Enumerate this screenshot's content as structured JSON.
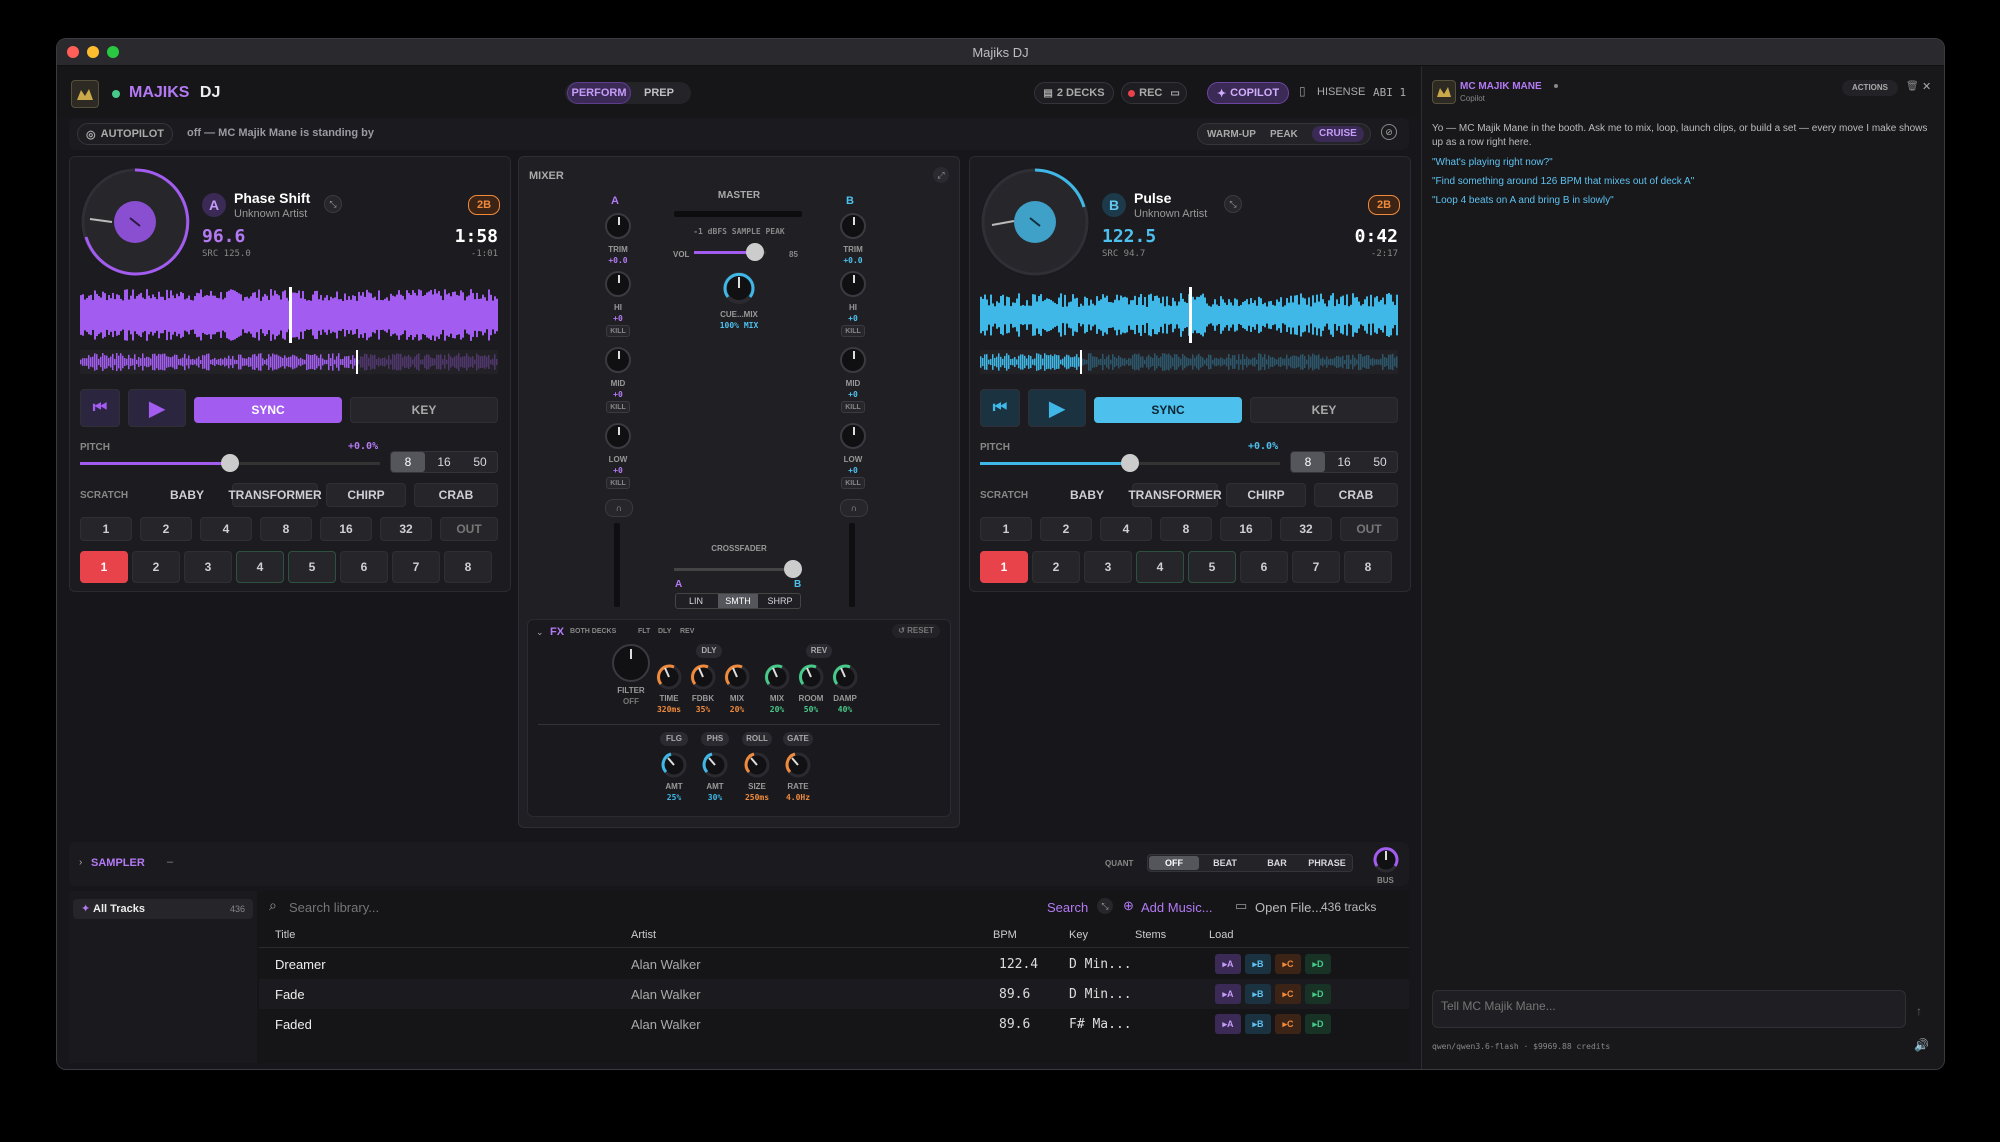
{
  "window": {
    "title": "Majiks DJ"
  },
  "brand": {
    "name_a": "MAJIKS",
    "name_b": "DJ"
  },
  "modes": {
    "perform": "PERFORM",
    "prep": "PREP"
  },
  "topbar": {
    "decks": "2 DECKS",
    "rec": "REC",
    "copilot": "COPILOT",
    "device": "HISENSE",
    "channel": "ABI 1"
  },
  "autopilot": {
    "label": "AUTOPILOT",
    "status": "off — MC Majik Mane is standing by",
    "levels": [
      "WARM-UP",
      "PEAK",
      "CRUISE"
    ]
  },
  "deck_a": {
    "letter": "A",
    "title": "Phase Shift",
    "artist": "Unknown Artist",
    "key": "2B",
    "bpm": "96.6",
    "src": "SRC 125.0",
    "time": "1:58",
    "remain": "-1:01",
    "sync": "SYNC",
    "keybtn": "KEY",
    "pitch_label": "PITCH",
    "pitch_val": "+0.0%",
    "pitch_position": 0.5,
    "ranges": [
      "8",
      "16",
      "50"
    ],
    "scratch": "SCRATCH",
    "scratch_modes": [
      "BABY",
      "TRANSFORMER",
      "CHIRP",
      "CRAB"
    ],
    "loops": [
      "1",
      "2",
      "4",
      "8",
      "16",
      "32",
      "OUT"
    ],
    "cues": [
      "1",
      "2",
      "3",
      "4",
      "5",
      "6",
      "7",
      "8"
    ],
    "color": "#a35cf0"
  },
  "deck_b": {
    "letter": "B",
    "title": "Pulse",
    "artist": "Unknown Artist",
    "key": "2B",
    "bpm": "122.5",
    "src": "SRC 94.7",
    "time": "0:42",
    "remain": "-2:17",
    "sync": "SYNC",
    "keybtn": "KEY",
    "pitch_label": "PITCH",
    "pitch_val": "+0.0%",
    "pitch_position": 0.5,
    "ranges": [
      "8",
      "16",
      "50"
    ],
    "scratch": "SCRATCH",
    "scratch_modes": [
      "BABY",
      "TRANSFORMER",
      "CHIRP",
      "CRAB"
    ],
    "loops": [
      "1",
      "2",
      "4",
      "8",
      "16",
      "32",
      "OUT"
    ],
    "cues": [
      "1",
      "2",
      "3",
      "4",
      "5",
      "6",
      "7",
      "8"
    ],
    "color": "#3fb8e8"
  },
  "mixer": {
    "title": "MIXER",
    "ch_a": "A",
    "ch_b": "B",
    "master": "MASTER",
    "peak": "-1 dBFS SAMPLE PEAK",
    "vol": "VOL",
    "vol_val": "85",
    "vol_level": 0.85,
    "cue_mix": "CUE...MIX",
    "mix_pct": "100% MIX",
    "eq": [
      {
        "name": "TRIM",
        "val": "+0.0"
      },
      {
        "name": "HI",
        "val": "+0",
        "kill": "KILL"
      },
      {
        "name": "MID",
        "val": "+0",
        "kill": "KILL"
      },
      {
        "name": "LOW",
        "val": "+0",
        "kill": "KILL"
      }
    ],
    "crossfader": "CROSSFADER",
    "xf_a": "A",
    "xf_b": "B",
    "curves": [
      "LIN",
      "SMTH",
      "SHRP"
    ]
  },
  "fx": {
    "title": "FX",
    "targets": [
      "BOTH DECKS",
      "FLT",
      "DLY",
      "REV"
    ],
    "reset": "RESET",
    "filter": "FILTER",
    "filter_val": "OFF",
    "dly": "DLY",
    "rev": "REV",
    "knobs1": [
      {
        "name": "TIME",
        "val": "320ms"
      },
      {
        "name": "FDBK",
        "val": "35%"
      },
      {
        "name": "MIX",
        "val": "20%"
      },
      {
        "name": "MIX",
        "val": "20%"
      },
      {
        "name": "ROOM",
        "val": "50%"
      },
      {
        "name": "DAMP",
        "val": "40%"
      }
    ],
    "tags2": [
      "FLG",
      "PHS",
      "ROLL",
      "GATE"
    ],
    "knobs2": [
      {
        "name": "AMT",
        "val": "25%"
      },
      {
        "name": "AMT",
        "val": "30%"
      },
      {
        "name": "SIZE",
        "val": "250ms"
      },
      {
        "name": "RATE",
        "val": "4.0Hz"
      }
    ]
  },
  "sampler": {
    "label": "SAMPLER",
    "dash": "–",
    "quant": "QUANT",
    "quant_opts": [
      "OFF",
      "BEAT",
      "BAR",
      "PHRASE"
    ],
    "bus": "BUS"
  },
  "library": {
    "all_tracks": "All Tracks",
    "count": "436",
    "search_placeholder": "Search library...",
    "search_btn": "Search",
    "add_music": "Add Music...",
    "open_file": "Open File...",
    "tracks": "436 tracks",
    "columns": [
      "Title",
      "Artist",
      "BPM",
      "Key",
      "Stems",
      "Load"
    ],
    "rows": [
      {
        "title": "Dreamer",
        "artist": "Alan Walker",
        "bpm": "122.4",
        "key": "D Min..."
      },
      {
        "title": "Fade",
        "artist": "Alan Walker",
        "bpm": "89.6",
        "key": "D Min..."
      },
      {
        "title": "Faded",
        "artist": "Alan Walker",
        "bpm": "89.6",
        "key": "F# Ma..."
      }
    ],
    "load": [
      "A",
      "B",
      "C",
      "D"
    ]
  },
  "copilot": {
    "name": "MC MAJIK MANE",
    "sub": "Copilot",
    "actions": "ACTIONS",
    "intro": "Yo — MC Majik Mane in the booth. Ask me to mix, loop, launch clips, or build a set — every move I make shows up as a row right here.",
    "suggestions": [
      "\"What's playing right now?\"",
      "\"Find something around 126 BPM that mixes out of deck A\"",
      "\"Loop 4 beats on A and bring B in slowly\""
    ],
    "placeholder": "Tell MC Majik Mane...",
    "model": "qwen/qwen3.6-flash · $9969.88 credits"
  },
  "colors": {
    "purple": "#a35cf0",
    "cyan": "#3fb8e8",
    "red": "#e8424a",
    "orange": "#f08a3c",
    "green": "#47c98a"
  }
}
